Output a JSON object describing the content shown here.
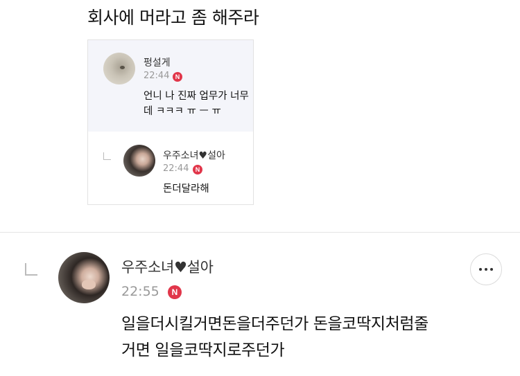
{
  "top_comment": {
    "text": "회사에 머라고 좀 해주라"
  },
  "quote": {
    "author": "펑설게",
    "time": "22:44",
    "badge": "N",
    "body_line1": "언니 나 진짜 업무가 너무",
    "body_line2": "데 ㅋㅋㅋ ㅠ ㅡ ㅠ",
    "reply": {
      "author": "우주소녀♥설아",
      "time": "22:44",
      "badge": "N",
      "body": "돈더달라해"
    }
  },
  "comment": {
    "author": "우주소녀♥설아",
    "time": "22:55",
    "badge": "N",
    "body_line1": "일을더시킬거면돈을더주던가 돈을코딱지처럼줄",
    "body_line2": "거면 일을코딱지로주던가"
  },
  "colors": {
    "badge": "#e1364a",
    "quote_bg": "#f4f5fa",
    "muted_text": "#999999"
  },
  "icons": {
    "more": "more-horizontal-icon",
    "reply": "reply-indent-icon"
  }
}
